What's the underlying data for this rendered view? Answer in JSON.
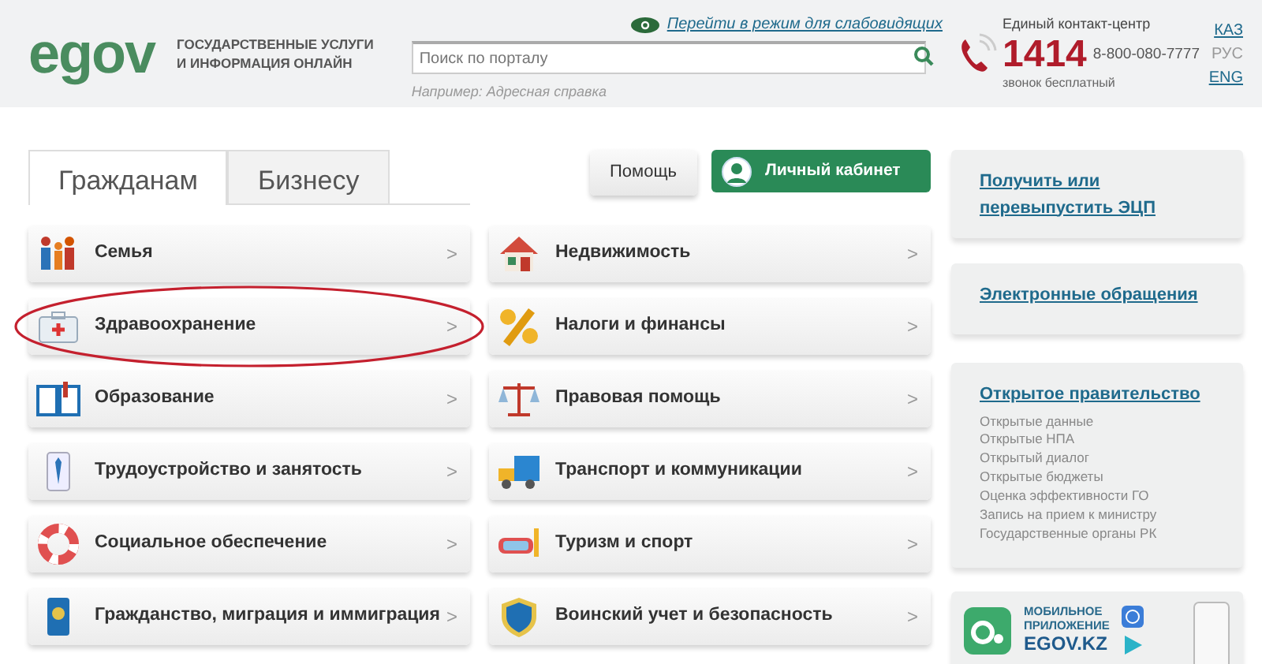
{
  "header": {
    "logo": "egov",
    "tagline": [
      "ГОСУДАРСТВЕННЫЕ УСЛУГИ",
      "И ИНФОРМАЦИЯ ОНЛАЙН"
    ],
    "accessibility_link": "Перейти в режим для слабовидящих",
    "search": {
      "placeholder": "Поиск по порталу",
      "hint_label": "Например:",
      "hint_link": "Адресная справка"
    },
    "contact": {
      "title": "Единый контакт-центр",
      "short_number": "1414",
      "phone": "8-800-080-7777",
      "note": "звонок бесплатный"
    },
    "languages": [
      {
        "label": "КАЗ",
        "selected": false
      },
      {
        "label": "РУС",
        "selected": true
      },
      {
        "label": "ENG",
        "selected": false
      }
    ]
  },
  "tabs": [
    {
      "label": "Гражданам",
      "selected": true
    },
    {
      "label": "Бизнесу",
      "selected": false
    }
  ],
  "buttons": {
    "help": "Помощь",
    "account": "Личный кабинет"
  },
  "categories_left": [
    {
      "label": "Семья",
      "highlighted": false
    },
    {
      "label": "Здравоохранение",
      "highlighted": true
    },
    {
      "label": "Образование",
      "highlighted": false
    },
    {
      "label": "Трудоустройство и занятость",
      "highlighted": false
    },
    {
      "label": "Социальное обеспечение",
      "highlighted": false
    },
    {
      "label": "Гражданство, миграция и иммиграция",
      "highlighted": false
    }
  ],
  "categories_right": [
    {
      "label": "Недвижимость",
      "highlighted": false
    },
    {
      "label": "Налоги и финансы",
      "highlighted": false
    },
    {
      "label": "Правовая помощь",
      "highlighted": false
    },
    {
      "label": "Транспорт и коммуникации",
      "highlighted": false
    },
    {
      "label": "Туризм и спорт",
      "highlighted": false
    },
    {
      "label": "Воинский учет и безопасность",
      "highlighted": false
    }
  ],
  "chevron": ">",
  "sidebar": {
    "ecp_link": "Получить или перевыпустить ЭЦП",
    "appeals_link": "Электронные обращения",
    "open_gov": {
      "title": "Открытое правительство",
      "links": [
        "Открытые данные",
        "Открытые НПА",
        "Открытый диалог",
        "Открытые бюджеты",
        "Оценка эффективности ГО",
        "Запись на прием к министру",
        "Государственные органы РК"
      ]
    },
    "app_banner": {
      "lines": [
        "МОБИЛЬНОЕ",
        "ПРИЛОЖЕНИЕ"
      ],
      "site": "EGOV.KZ"
    }
  }
}
